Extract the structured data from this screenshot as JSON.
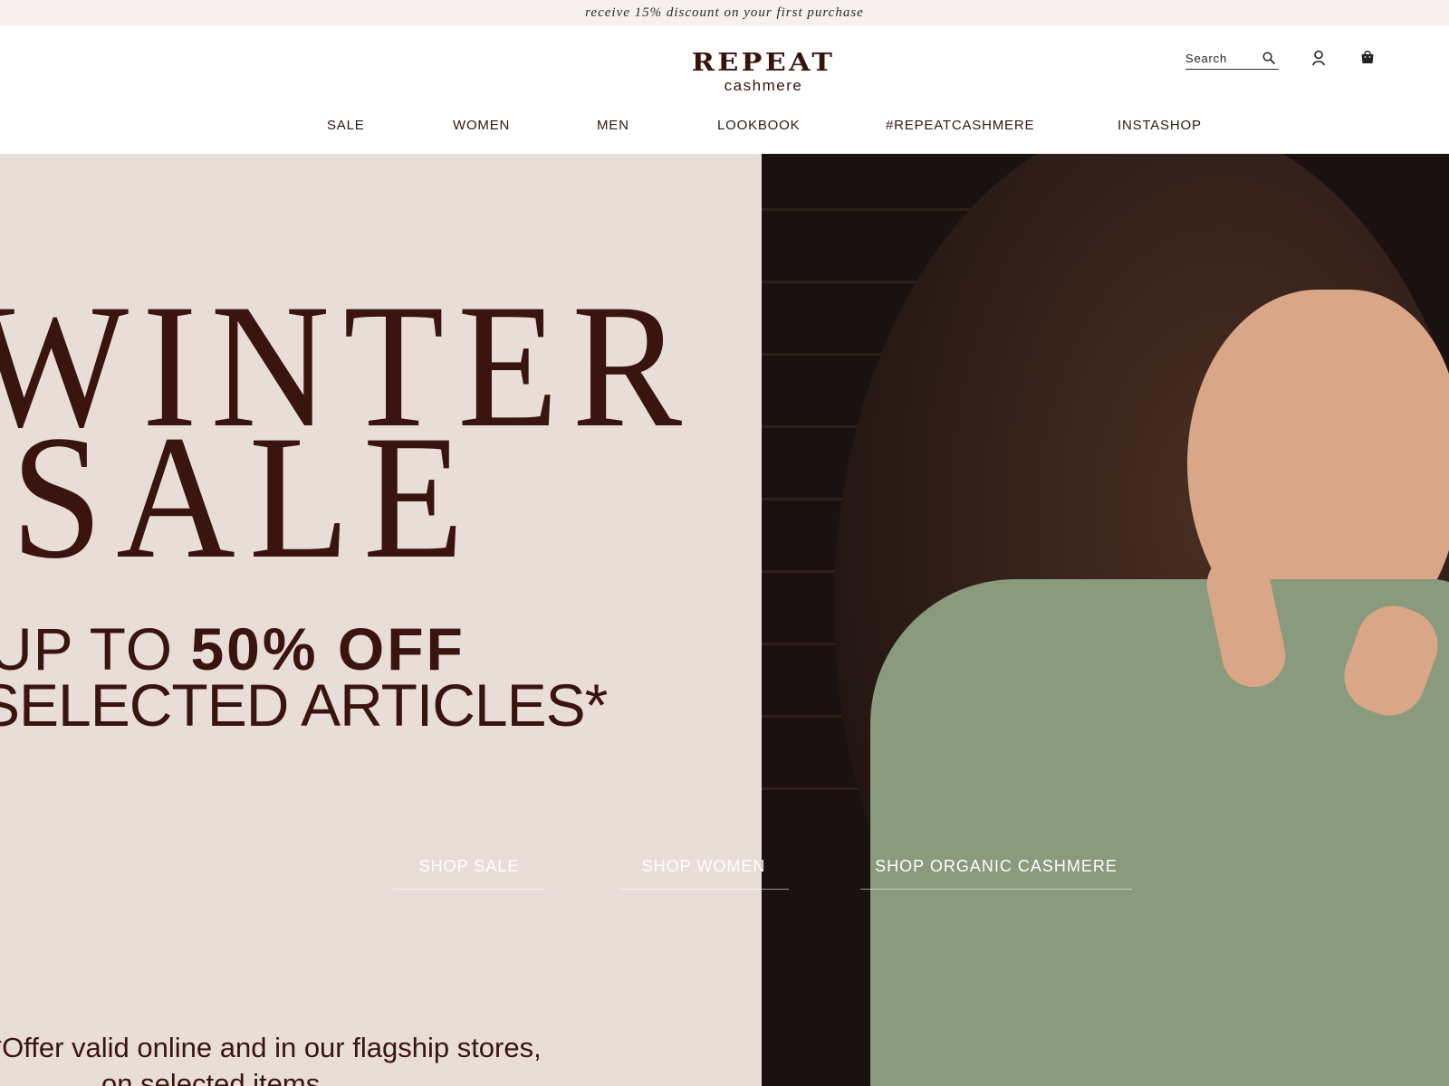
{
  "promo": {
    "text": "receive 15% discount on your first purchase"
  },
  "header": {
    "logo": {
      "main": "REPEAT",
      "sub": "cashmere"
    },
    "search": {
      "placeholder": "Search"
    },
    "icons": [
      "search-icon",
      "user-icon",
      "shopping-bag-icon"
    ]
  },
  "nav": {
    "items": [
      {
        "label": "SALE"
      },
      {
        "label": "WOMEN"
      },
      {
        "label": "MEN"
      },
      {
        "label": "LOOKBOOK"
      },
      {
        "label": "#REPEATCASHMERE"
      },
      {
        "label": "INSTASHOP"
      }
    ]
  },
  "hero": {
    "headline_1": "WINTER",
    "headline_2": "SALE",
    "offer_prefix": "UP TO ",
    "offer_bold": "50% OFF",
    "offer_line_2": "SELECTED ARTICLES*",
    "footnote_1": "*Offer valid online and in our flagship stores,",
    "footnote_2": "on selected items",
    "ctas": [
      {
        "label": "SHOP SALE"
      },
      {
        "label": "SHOP WOMEN"
      },
      {
        "label": "SHOP ORGANIC CASHMERE"
      }
    ]
  },
  "colors": {
    "brand": "#3a140e",
    "promo_bg": "#f6f1ef",
    "hero_bg": "#e9ddd8",
    "sweater": "#8a9a7c"
  }
}
